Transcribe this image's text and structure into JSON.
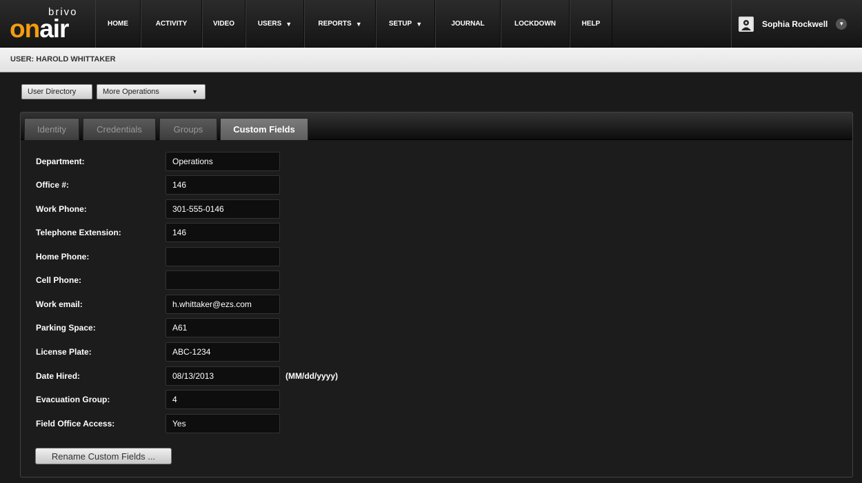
{
  "brand": {
    "small": "brivo",
    "on": "on",
    "air": "air"
  },
  "nav": [
    {
      "label": "HOME",
      "caret": false
    },
    {
      "label": "ACTIVITY",
      "caret": false
    },
    {
      "label": "VIDEO",
      "caret": false
    },
    {
      "label": "USERS",
      "caret": true
    },
    {
      "label": "REPORTS",
      "caret": true
    },
    {
      "label": "SETUP",
      "caret": true
    },
    {
      "label": "JOURNAL",
      "caret": false
    },
    {
      "label": "LOCKDOWN",
      "caret": false
    },
    {
      "label": "HELP",
      "caret": false
    }
  ],
  "user": {
    "name": "Sophia Rockwell",
    "avatar_icon": "user-badge-icon"
  },
  "page": {
    "title": "USER: HAROLD WHITTAKER"
  },
  "toolbar": {
    "directory_label": "User Directory",
    "more_label": "More Operations"
  },
  "tabs": {
    "identity": "Identity",
    "credentials": "Credentials",
    "groups": "Groups",
    "custom_fields": "Custom Fields",
    "active": "custom_fields"
  },
  "fields": [
    {
      "label": "Department:",
      "value": "Operations"
    },
    {
      "label": "Office #:",
      "value": "146"
    },
    {
      "label": "Work Phone:",
      "value": "301-555-0146"
    },
    {
      "label": "Telephone Extension:",
      "value": "146"
    },
    {
      "label": "Home Phone:",
      "value": ""
    },
    {
      "label": "Cell Phone:",
      "value": ""
    },
    {
      "label": "Work email:",
      "value": "h.whittaker@ezs.com"
    },
    {
      "label": "Parking Space:",
      "value": "A61"
    },
    {
      "label": "License Plate:",
      "value": "ABC-1234"
    },
    {
      "label": "Date Hired:",
      "value": "08/13/2013",
      "hint": "(MM/dd/yyyy)"
    },
    {
      "label": "Evacuation Group:",
      "value": "4"
    },
    {
      "label": "Field Office Access:",
      "value": "Yes"
    }
  ],
  "actions": {
    "rename_label": "Rename Custom Fields ..."
  },
  "colors": {
    "accent": "#f39c12",
    "nav_bg": "#1e1e1e",
    "panel_bg": "#1c1c1c"
  }
}
